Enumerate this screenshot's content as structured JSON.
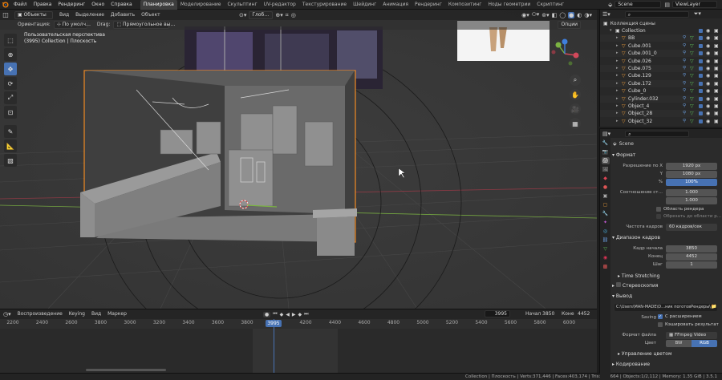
{
  "menu": [
    "Файл",
    "Правка",
    "Рендеринг",
    "Окно",
    "Справка"
  ],
  "workspaces": [
    "Планировка",
    "Моделирование",
    "Скульптинг",
    "UV-редактор",
    "Текстурирование",
    "Шейдинг",
    "Анимация",
    "Рендеринг",
    "Композитинг",
    "Ноды геометрии",
    "Скриптинг"
  ],
  "scene_name": "Scene",
  "view_layer": "ViewLayer",
  "viewport": {
    "mode": "Объекты",
    "menus": [
      "Вид",
      "Выделение",
      "Добавить",
      "Объект"
    ],
    "pivot": "Глоб…",
    "orientation_label": "Ориентация:",
    "orientation_value": "По умолч…",
    "drag_label": "Drag:",
    "drag_value": "Прямоугольное вы…",
    "options": "Опции",
    "info_line1": "Пользовательская перспектива",
    "info_line2": "(3995) Collection | Плоскость",
    "gizmo_axes": [
      "X",
      "Y",
      "Z"
    ]
  },
  "outliner": {
    "title": "Коллекция сцены",
    "items": [
      {
        "name": "Collection",
        "indent": 1
      },
      {
        "name": "BB",
        "indent": 2
      },
      {
        "name": "Cube.001",
        "indent": 2
      },
      {
        "name": "Cube.001_0",
        "indent": 2
      },
      {
        "name": "Cube.026",
        "indent": 2
      },
      {
        "name": "Cube.075",
        "indent": 2
      },
      {
        "name": "Cube.129",
        "indent": 2
      },
      {
        "name": "Cube.172",
        "indent": 2
      },
      {
        "name": "Cube_0",
        "indent": 2
      },
      {
        "name": "Cylinder.032",
        "indent": 2
      },
      {
        "name": "Object_4",
        "indent": 2
      },
      {
        "name": "Object_28",
        "indent": 2
      },
      {
        "name": "Object_32",
        "indent": 2
      }
    ]
  },
  "properties": {
    "scene": "Scene",
    "format_title": "Формат",
    "res_x_label": "Разрешение по X",
    "res_x": "1920 px",
    "res_y_label": "Y",
    "res_y": "1080 px",
    "res_pct_label": "%",
    "res_pct": "100%",
    "aspect_label": "Соотношение ст…",
    "aspect_x": "1.000",
    "aspect_y": "1.000",
    "render_region": "Область рендера",
    "crop_region": "Обрезать до области р…",
    "fps_label": "Частота кадров",
    "fps": "60 кадров/сек",
    "range_title": "Диапазон кадров",
    "start_label": "Кадр начала",
    "start": "3850",
    "end_label": "Конец",
    "end": "4452",
    "step_label": "Шаг",
    "step": "1",
    "time_stretching": "Time Stretching",
    "stereoscopy": "Стереоскопия",
    "output_title": "Вывод",
    "output_path": "C:\\Users\\MAN-MADE\\D…ник поготовРендеры\\",
    "saving_label": "Saving",
    "file_ext": "С расширением",
    "cache_result": "Кэшировать результат",
    "file_format_label": "Формат файла",
    "file_format": "FFmpeg Video",
    "color_label": "Цвет",
    "color_bw": "BW",
    "color_rgb": "RGB",
    "color_mgmt": "Управление цветом",
    "encoding": "Кодирование"
  },
  "timeline": {
    "menus": [
      "Воспроизведение",
      "Keying",
      "Вид",
      "Маркер"
    ],
    "current_frame": "3995",
    "start_label": "Начал",
    "start": "3850",
    "end_label": "Коне",
    "end": "4452",
    "ticks": [
      "2200",
      "2400",
      "2600",
      "3800",
      "3000",
      "3200",
      "3400",
      "3600",
      "3800",
      "3995",
      "4200",
      "4400",
      "4600",
      "4800",
      "5000",
      "5200",
      "5400",
      "5600",
      "5800",
      "6000"
    ],
    "playhead_frame": "3995"
  },
  "status": "Collection | Плоскость | Verts:371,446 | Faces:403,174 | Tris:633,664 | Objects:1/2,112 | Memory: 1.35 GiB | 3.5.1",
  "colors": {
    "accent": "#4772b3",
    "selection_outline": "#f08a24",
    "x_axis": "#d2485a",
    "y_axis": "#7bb342",
    "z_axis": "#3f7fdd"
  }
}
